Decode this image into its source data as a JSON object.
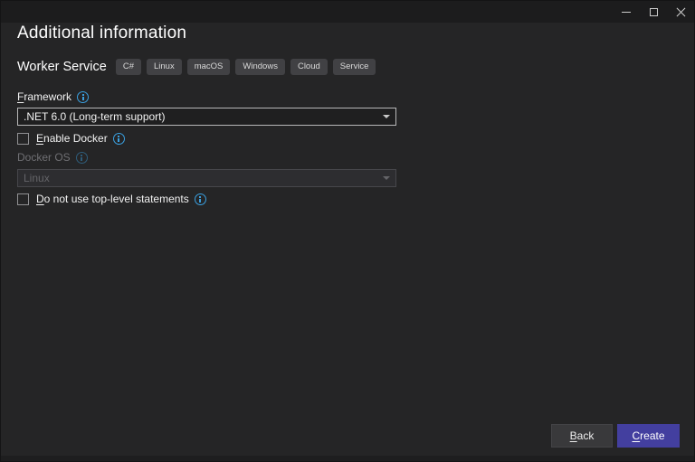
{
  "header": {
    "title": "Additional information"
  },
  "template": {
    "name": "Worker Service",
    "tags": [
      "C#",
      "Linux",
      "macOS",
      "Windows",
      "Cloud",
      "Service"
    ]
  },
  "form": {
    "framework": {
      "label": "Framework",
      "value": ".NET 6.0 (Long-term support)",
      "enabled": true
    },
    "enable_docker": {
      "label": "Enable Docker",
      "checked": false
    },
    "docker_os": {
      "label": "Docker OS",
      "value": "Linux",
      "enabled": false
    },
    "top_level_statements": {
      "label": "Do not use top-level statements",
      "checked": false
    }
  },
  "footer": {
    "back_label": "Back",
    "create_label": "Create"
  },
  "icons": {
    "info": "info-icon",
    "minimize": "minimize-icon",
    "maximize": "maximize-icon",
    "close": "close-icon",
    "dropdown_caret": "chevron-down-icon"
  },
  "colors": {
    "accent": "#433f9f",
    "info": "#3aa0e0",
    "window_bg": "#252526",
    "titlebar_bg": "#1c1c1d",
    "select_bg": "#1f1f20",
    "disabled_text": "#6f6f73"
  }
}
